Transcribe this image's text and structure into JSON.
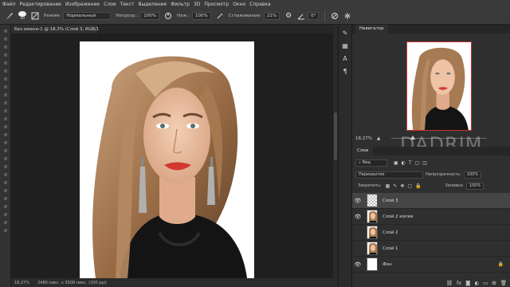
{
  "menu": [
    "Файл",
    "Редактирование",
    "Изображение",
    "Слои",
    "Текст",
    "Выделение",
    "Фильтр",
    "3D",
    "Просмотр",
    "Окно",
    "Справка"
  ],
  "options": {
    "brush_size": "30",
    "mode_label": "Режим:",
    "mode_value": "Нормальный",
    "opacity_label": "Непрозр.:",
    "opacity_value": "100%",
    "pressure_label": "Наж.:",
    "pressure_value": "100%",
    "smoothing_label": "Сглаживание:",
    "smoothing_value": "21%",
    "angle_value": "0°"
  },
  "document_tab": "Без имени-1 @ 18,3% (Слой 3, RGB/16) *",
  "status": {
    "zoom": "18,27%",
    "dimensions": "2480 пикс. x 3508 пикс. (300 ppi)"
  },
  "navigator": {
    "tab": "Навигатор",
    "zoom": "18,27%",
    "watermark": "DADRIM"
  },
  "layers_panel": {
    "tab": "Слои",
    "filter_label": "Вид",
    "blend_mode": "Перекрытие",
    "opacity_label": "Непрозрачность:",
    "opacity_value": "100%",
    "lock_label": "Закрепить:",
    "fill_label": "Заливка:",
    "fill_value": "100%",
    "layers": [
      {
        "name": "Слой 3",
        "selected": true,
        "thumb": "transparent"
      },
      {
        "name": "Слой 2 копия",
        "selected": false,
        "thumb": "photo"
      },
      {
        "name": "Слой 2",
        "selected": false,
        "thumb": "photo"
      },
      {
        "name": "Слой 1",
        "selected": false,
        "thumb": "photo"
      },
      {
        "name": "Фон",
        "selected": false,
        "thumb": "white",
        "italic": true
      }
    ]
  },
  "colors": {
    "accent_red": "#d03030",
    "panel_bg": "#2f2f2f",
    "selected_layer": "#454545"
  }
}
